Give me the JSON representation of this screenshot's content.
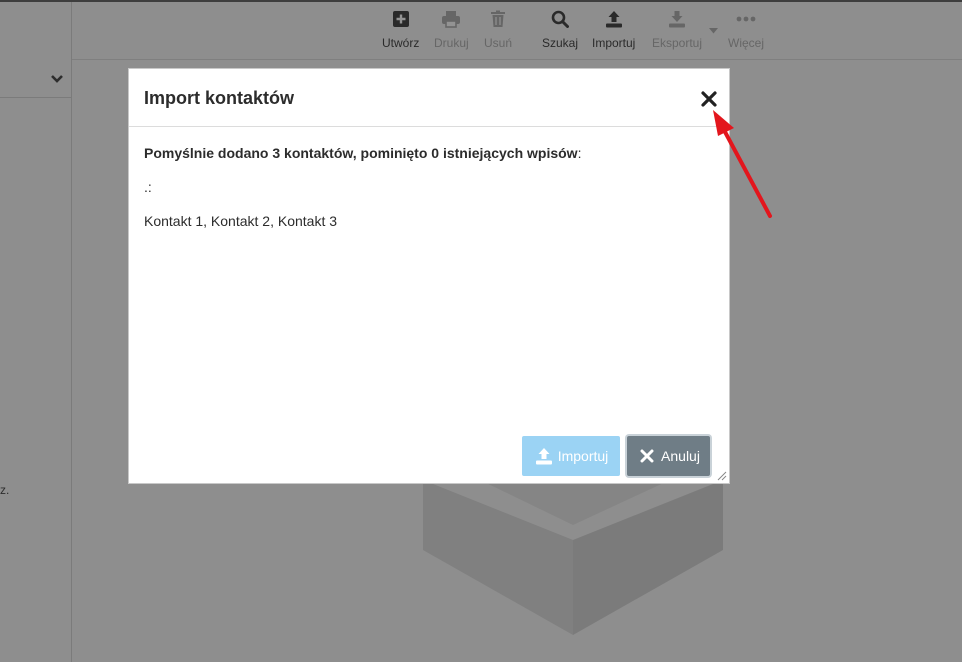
{
  "toolbar": {
    "items": [
      {
        "label": "Utwórz",
        "icon": "plus-square-icon",
        "enabled": true
      },
      {
        "label": "Drukuj",
        "icon": "printer-icon",
        "enabled": false
      },
      {
        "label": "Usuń",
        "icon": "trash-icon",
        "enabled": false
      },
      {
        "label": "Szukaj",
        "icon": "search-icon",
        "enabled": true
      },
      {
        "label": "Importuj",
        "icon": "upload-icon",
        "enabled": true
      },
      {
        "label": "Eksportuj",
        "icon": "download-icon",
        "enabled": false
      },
      {
        "label": "Więcej",
        "icon": "more-dots-icon",
        "enabled": false
      }
    ]
  },
  "sidebar": {
    "fragment_text": "z."
  },
  "dialog": {
    "title": "Import kontaktów",
    "message_bold": "Pomyślnie dodano 3 kontaktów, pominięto 0 istniejących wpisów",
    "message_colon": ":",
    "separator": ".:",
    "contacts": "Kontakt 1, Kontakt 2, Kontakt 3",
    "import_label": "Importuj",
    "cancel_label": "Anuluj"
  },
  "colors": {
    "import_button": "#9bd3f4",
    "cancel_button": "#6f7d86",
    "annotation_arrow": "#e3161d"
  }
}
